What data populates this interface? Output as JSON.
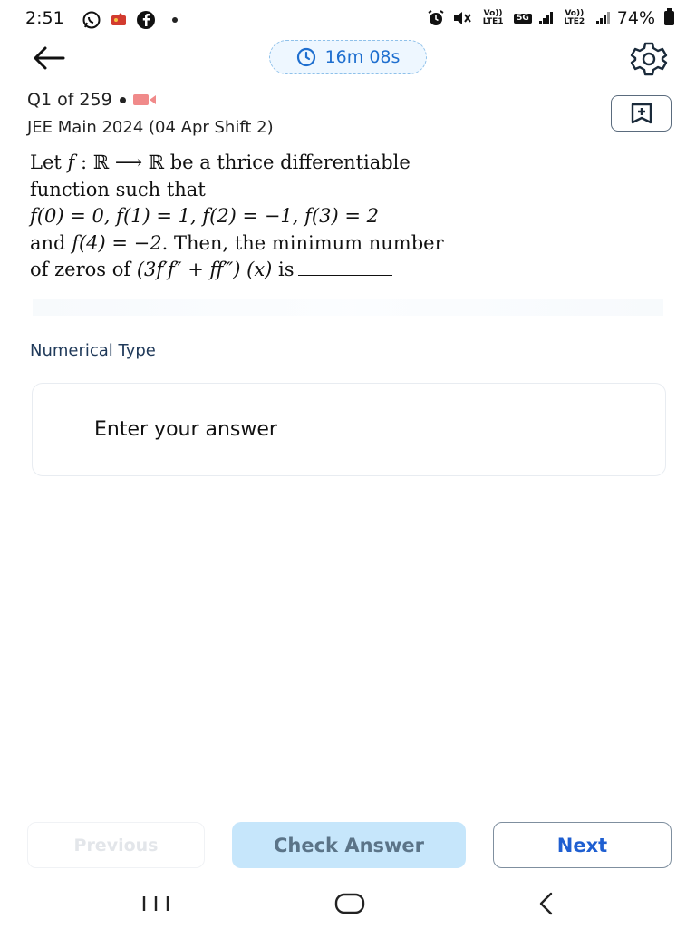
{
  "status": {
    "time": "2:51",
    "battery": "74%",
    "badges": {
      "volte1": "Vo)) LTE1",
      "fiveg": "5G",
      "volte2": "Vo)) LTE2"
    }
  },
  "timer": {
    "text": "16m 08s",
    "icon": "clock-icon"
  },
  "question_meta": {
    "counter": "Q1 of 259",
    "exam": "JEE Main 2024 (04 Apr Shift 2)"
  },
  "question": {
    "l1a": "Let ",
    "l1f": "f",
    "l1b": " : ℝ ⟶ ℝ be a thrice differentiable",
    "l2": "function such that",
    "l3": "f(0) = 0, f(1) = 1, f(2) = −1, f(3) = 2",
    "l4a": "and ",
    "l4f": "f(4) = −2",
    "l4b": ". Then, the minimum number",
    "l5a": "of zeros of ",
    "l5f": "(3f′f″ + ff‴) (x)",
    "l5b": " is"
  },
  "answer": {
    "type_label": "Numerical Type",
    "placeholder": "Enter your answer"
  },
  "buttons": {
    "previous": "Previous",
    "check": "Check Answer",
    "next": "Next"
  },
  "colors": {
    "accent": "#1f5fd1",
    "timer_bg": "#eef7ff",
    "check_bg": "#c6e6fb"
  }
}
